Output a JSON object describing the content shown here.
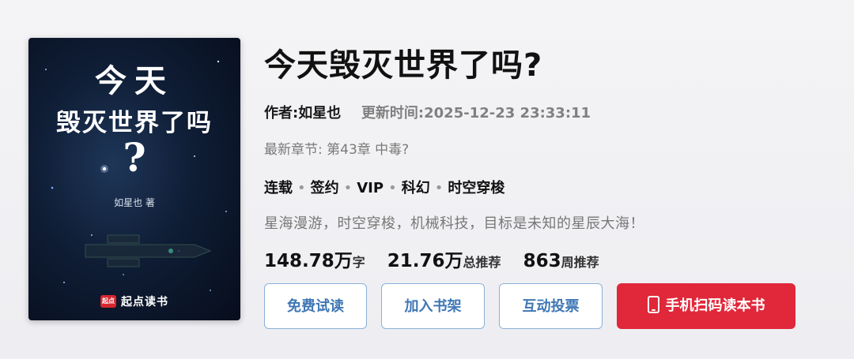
{
  "cover": {
    "title_line1": "今天",
    "title_line2": "毁灭世界了吗",
    "title_line3": "?",
    "author": "如星也 著",
    "brand_logo": "起点",
    "brand": "起点读书"
  },
  "book": {
    "title": "今天毁灭世界了吗?",
    "author": "作者:如星也",
    "update_time": "更新时间:2025-12-23 23:33:11",
    "latest_chapter": "最新章节: 第43章 中毒?",
    "tags": [
      "连载",
      "签约",
      "VIP",
      "科幻",
      "时空穿梭"
    ],
    "intro": "星海漫游，时空穿梭，机械科技，目标是未知的星辰大海！"
  },
  "stats": {
    "words_num": "148.78万",
    "words_unit": "字",
    "recommend_num": "21.76万",
    "recommend_unit": "总推荐",
    "weekly_num": "863",
    "weekly_unit": "周推荐"
  },
  "buttons": {
    "free_read": "免费试读",
    "add_shelf": "加入书架",
    "vote": "互动投票",
    "mobile": "手机扫码读本书"
  },
  "colors": {
    "accent_blue": "#3f77b5",
    "accent_red": "#e0283a"
  }
}
